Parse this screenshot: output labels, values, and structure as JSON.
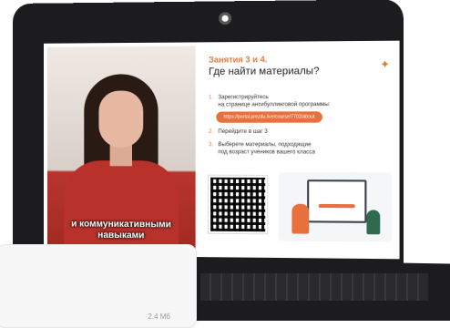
{
  "video": {
    "subtitle_line1": "и коммуникативными",
    "subtitle_line2": "навыками"
  },
  "slide": {
    "title_line1": "Занятия 3 и 4.",
    "title_line2": "Где найти материалы?",
    "steps": [
      {
        "num": "1.",
        "text_line1": "Зарегистрируйтесь",
        "text_line2": "на странице антибуллинговой программы:"
      },
      {
        "num": "2.",
        "text_line1": "Перейдите в шаг 3",
        "text_line2": ""
      },
      {
        "num": "3.",
        "text_line1": "Выберете материалы, подходящие",
        "text_line2": "под возраст учеников вашего класса"
      }
    ],
    "link": "https://portal.prezdu.live/course/7702/about"
  },
  "file_card": {
    "size": "2.4 Мб"
  },
  "colors": {
    "accent": "#e8703c",
    "bezel": "#1c1c1e"
  }
}
